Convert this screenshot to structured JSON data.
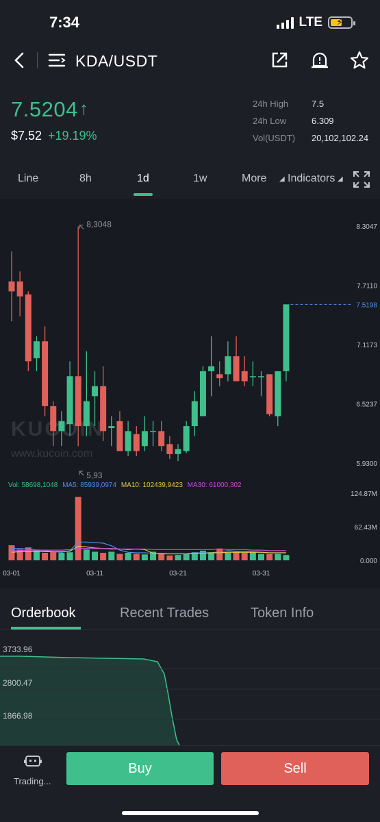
{
  "status_bar": {
    "time": "7:34",
    "network": "LTE"
  },
  "nav": {
    "pair": "KDA/USDT",
    "icons": [
      "back-icon",
      "menu-icon",
      "share-icon",
      "price-alert-icon",
      "star-icon"
    ]
  },
  "ticker": {
    "price": "7.5204",
    "price_usd": "$7.52",
    "change": "+19.19%",
    "stats": [
      {
        "label": "24h High",
        "value": "7.5"
      },
      {
        "label": "24h Low",
        "value": "6.309"
      },
      {
        "label": "Vol(USDT)",
        "value": "20,102,102.24"
      }
    ]
  },
  "timeframe_tabs": [
    "Line",
    "8h",
    "1d",
    "1w",
    "More",
    "Indicators"
  ],
  "active_timeframe": "1d",
  "colors": {
    "up": "#3fbf8c",
    "down": "#e0605a",
    "bg": "#1c1f26",
    "chart_bg": "#171a20",
    "ma5": "#4d8fe8",
    "ma10": "#e8c547",
    "ma30": "#c94fd6"
  },
  "watermark": {
    "brand": "KUCOIN",
    "url": "www.kucoin.com"
  },
  "volume_legend": {
    "vol": "Vol: 58698,1048",
    "ma5": "MA5: 85939,0974",
    "ma10": "MA10: 102439,9423",
    "ma30": "MA30: 61000,302"
  },
  "chart_data": {
    "type": "candlestick",
    "price_axis_labels": [
      "8.3047",
      "7.7110",
      "7.1173",
      "6.5237",
      "5.9300"
    ],
    "price_range": [
      5.93,
      8.3047
    ],
    "last_price_label": "7.5198",
    "high_marker": "8,3048",
    "low_marker": "5,93",
    "volume_axis_labels": [
      "124.87M",
      "62.43M",
      "0.000"
    ],
    "x_ticks": [
      "03-01",
      "03-11",
      "03-21",
      "03-31"
    ],
    "candles": [
      {
        "o": 7.75,
        "h": 8.05,
        "l": 7.35,
        "c": 7.65
      },
      {
        "o": 7.75,
        "h": 7.85,
        "l": 7.4,
        "c": 7.6
      },
      {
        "o": 7.62,
        "h": 7.65,
        "l": 6.85,
        "c": 6.95
      },
      {
        "o": 6.98,
        "h": 7.2,
        "l": 6.85,
        "c": 7.15
      },
      {
        "o": 7.15,
        "h": 7.3,
        "l": 6.4,
        "c": 6.5
      },
      {
        "o": 6.5,
        "h": 6.55,
        "l": 6.1,
        "c": 6.25
      },
      {
        "o": 6.25,
        "h": 6.45,
        "l": 6.1,
        "c": 6.35
      },
      {
        "o": 6.32,
        "h": 6.95,
        "l": 6.2,
        "c": 6.8
      },
      {
        "o": 6.8,
        "h": 8.3,
        "l": 6.1,
        "c": 6.3
      },
      {
        "o": 6.3,
        "h": 7.05,
        "l": 6.2,
        "c": 6.55
      },
      {
        "o": 6.6,
        "h": 6.85,
        "l": 6.3,
        "c": 6.7
      },
      {
        "o": 6.7,
        "h": 6.9,
        "l": 6.15,
        "c": 6.25
      },
      {
        "o": 6.28,
        "h": 6.4,
        "l": 6.1,
        "c": 6.3
      },
      {
        "o": 6.35,
        "h": 6.45,
        "l": 6.05,
        "c": 6.05
      },
      {
        "o": 6.05,
        "h": 6.35,
        "l": 6.0,
        "c": 6.25
      },
      {
        "o": 6.22,
        "h": 6.3,
        "l": 6.0,
        "c": 6.05
      },
      {
        "o": 6.1,
        "h": 6.4,
        "l": 6.05,
        "c": 6.25
      },
      {
        "o": 6.25,
        "h": 6.35,
        "l": 6.1,
        "c": 6.25
      },
      {
        "o": 6.25,
        "h": 6.35,
        "l": 6.05,
        "c": 6.1
      },
      {
        "o": 6.12,
        "h": 6.2,
        "l": 5.97,
        "c": 6.02
      },
      {
        "o": 6.02,
        "h": 6.12,
        "l": 5.95,
        "c": 6.07
      },
      {
        "o": 6.05,
        "h": 6.35,
        "l": 6.03,
        "c": 6.3
      },
      {
        "o": 6.3,
        "h": 6.65,
        "l": 6.2,
        "c": 6.55
      },
      {
        "o": 6.4,
        "h": 6.9,
        "l": 6.4,
        "c": 6.85
      },
      {
        "o": 6.85,
        "h": 7.2,
        "l": 6.6,
        "c": 6.9
      },
      {
        "o": 6.82,
        "h": 6.95,
        "l": 6.7,
        "c": 6.78
      },
      {
        "o": 6.82,
        "h": 7.15,
        "l": 6.75,
        "c": 7.0
      },
      {
        "o": 7.0,
        "h": 7.2,
        "l": 6.75,
        "c": 6.75
      },
      {
        "o": 6.85,
        "h": 7.0,
        "l": 6.7,
        "c": 6.75
      },
      {
        "o": 6.8,
        "h": 6.95,
        "l": 6.7,
        "c": 6.8
      },
      {
        "o": 6.8,
        "h": 6.85,
        "l": 6.6,
        "c": 6.8
      },
      {
        "o": 6.82,
        "h": 6.82,
        "l": 6.4,
        "c": 6.42
      },
      {
        "o": 6.4,
        "h": 6.85,
        "l": 6.3,
        "c": 6.85
      },
      {
        "o": 6.85,
        "h": 7.52,
        "l": 6.75,
        "c": 7.52
      }
    ],
    "volumes": [
      28,
      20,
      24,
      20,
      14,
      16,
      14,
      15,
      118,
      20,
      16,
      14,
      16,
      12,
      14,
      12,
      11,
      16,
      12,
      9,
      10,
      12,
      15,
      18,
      15,
      22,
      14,
      16,
      14,
      16,
      12,
      12,
      12,
      10
    ],
    "volume_max": 124.87,
    "ma_volume": {
      "ma5": [
        22,
        22,
        21,
        19,
        18,
        16,
        15,
        18,
        34,
        34,
        33,
        32,
        27,
        19,
        15,
        14,
        14,
        13,
        13,
        12,
        12,
        12,
        14,
        14,
        14,
        16,
        18,
        17,
        17,
        16,
        15,
        14,
        14,
        14
      ],
      "ma10": [
        15,
        16,
        16,
        16,
        16,
        16,
        16,
        17,
        26,
        25,
        23,
        22,
        21,
        21,
        20,
        21,
        20,
        13,
        12,
        12,
        12,
        12,
        13,
        13,
        14,
        14,
        15,
        15,
        15,
        15,
        15,
        14,
        14,
        14
      ],
      "ma30": [
        18,
        18,
        19,
        19,
        19,
        19,
        19,
        20,
        22,
        22,
        22,
        22,
        22,
        21,
        21,
        21,
        21,
        20,
        20,
        20,
        20,
        20,
        20,
        20,
        20,
        21,
        20,
        20,
        20,
        19,
        19,
        18,
        18,
        18
      ]
    }
  },
  "orderbook_tabs": [
    "Orderbook",
    "Recent Trades",
    "Token Info"
  ],
  "depth_axis_labels": [
    "3733.96",
    "2800.47",
    "1866.98"
  ],
  "bottom": {
    "trading_label": "Trading...",
    "buy": "Buy",
    "sell": "Sell"
  }
}
